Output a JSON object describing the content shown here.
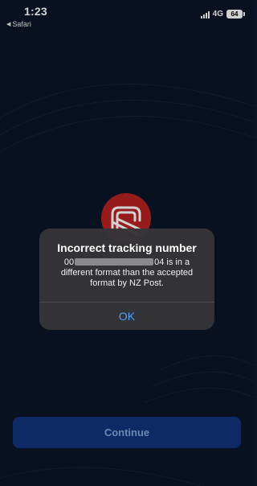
{
  "status_bar": {
    "time": "1:23",
    "back_app": "Safari",
    "network": "4G",
    "battery": "64"
  },
  "brand": {
    "logo_icon": "nz-post-logo",
    "color": "#b82221"
  },
  "alert": {
    "title": "Incorrect tracking number",
    "message_prefix": "00",
    "message_suffix": "04 is in a different format than the accepted format by NZ Post.",
    "ok_label": "OK",
    "accent": "#4da3ff"
  },
  "continue": {
    "label": "Continue"
  }
}
